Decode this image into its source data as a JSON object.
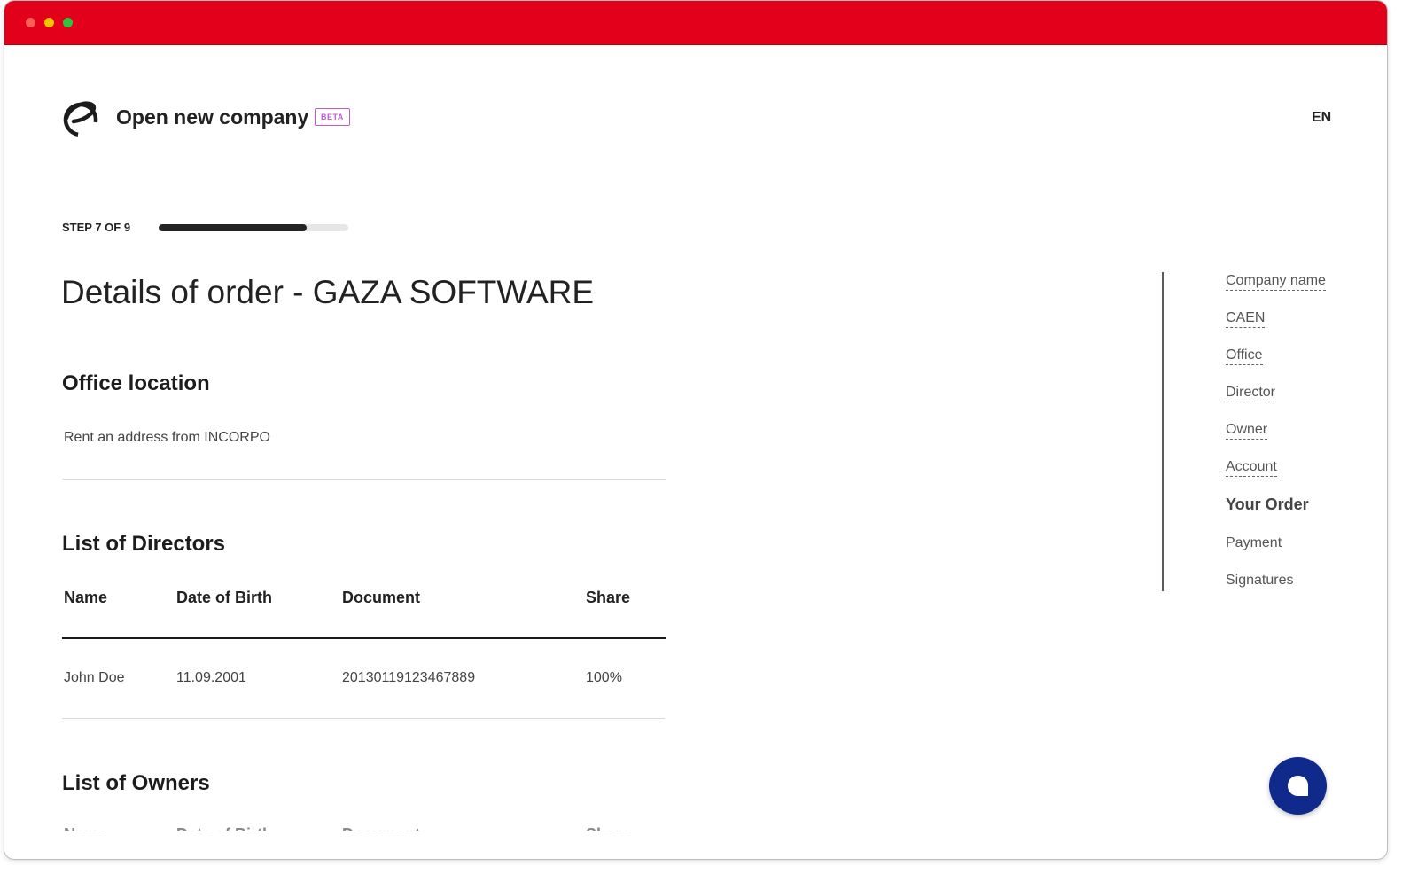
{
  "header": {
    "app_title": "Open new company",
    "beta_label": "BETA",
    "language": "EN"
  },
  "progress": {
    "label": "STEP 7 OF 9",
    "current": 7,
    "total": 9,
    "fraction": 0.78
  },
  "page_title": "Details of order - GAZA SOFTWARE",
  "office": {
    "title": "Office location",
    "value": "Rent an address from INCORPO"
  },
  "directors": {
    "title": "List of Directors",
    "columns": [
      "Name",
      "Date of Birth",
      "Document",
      "Share"
    ],
    "rows": [
      [
        "John Doe",
        "11.09.2001",
        "20130119123467889",
        "100%"
      ]
    ]
  },
  "owners": {
    "title": "List of Owners",
    "columns": [
      "Name",
      "Date of Birth",
      "Document",
      "Share"
    ]
  },
  "sidebar": {
    "items": [
      {
        "label": "Company name",
        "state": "done"
      },
      {
        "label": "CAEN",
        "state": "done"
      },
      {
        "label": "Office",
        "state": "done"
      },
      {
        "label": "Director",
        "state": "done"
      },
      {
        "label": "Owner",
        "state": "done"
      },
      {
        "label": "Account",
        "state": "done"
      },
      {
        "label": "Your Order",
        "state": "active"
      },
      {
        "label": "Payment",
        "state": "pending"
      },
      {
        "label": "Signatures",
        "state": "pending"
      }
    ]
  },
  "colors": {
    "titlebar": "#e2001a",
    "beta_badge": "#c35ad6",
    "chat_button": "#0f2a8a",
    "progress_fill": "#232323"
  },
  "icons": {
    "logo": "company-logo-icon",
    "chat": "chat-bubble-icon"
  }
}
